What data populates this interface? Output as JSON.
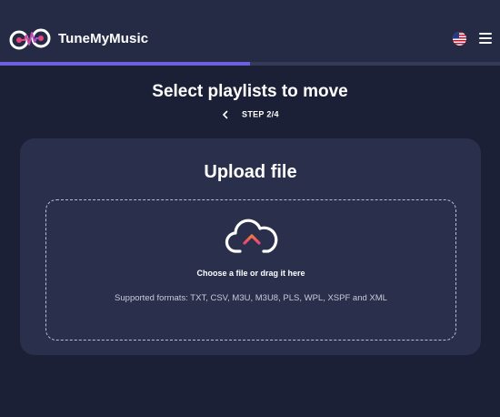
{
  "app": {
    "brand_name": "TuneMyMusic",
    "logo_icon": "tunemymusic-logo-icon",
    "language_icon": "us-flag-icon",
    "menu_icon": "hamburger-menu-icon"
  },
  "progress": {
    "fraction": 0.5,
    "fill_color": "#6c5fe0"
  },
  "page": {
    "title": "Select playlists to move",
    "step_label": "STEP 2/4",
    "back_icon": "chevron-left-icon"
  },
  "upload": {
    "title": "Upload file",
    "icon": "cloud-upload-icon",
    "drop_label": "Choose a file or drag it here",
    "formats_text": "Supported formats: TXT, CSV, M3U, M3U8, PLS, WPL, XSPF and XML"
  },
  "colors": {
    "background": "#1c2036",
    "header": "#262b45",
    "card": "#2a2f4c",
    "accent_gradient_start": "#e8457a",
    "accent_gradient_end": "#f07a3c"
  }
}
